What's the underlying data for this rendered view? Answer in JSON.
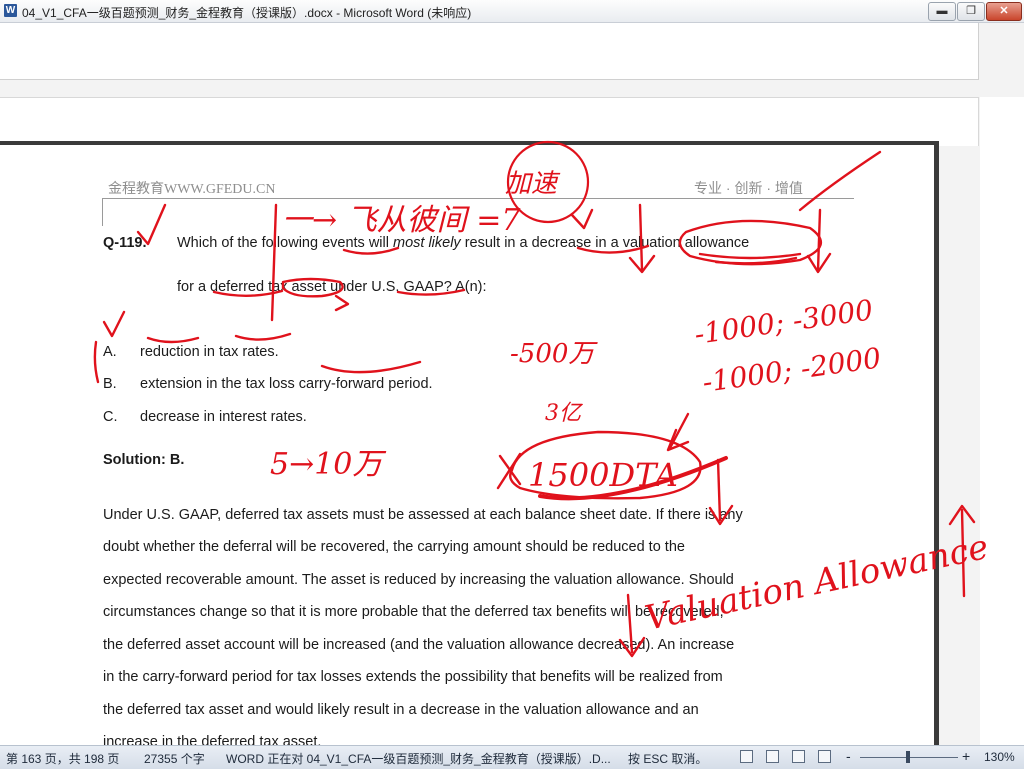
{
  "window": {
    "title": "04_V1_CFA一级百题预测_财务_金程教育（授课版）.docx - Microsoft Word (未响应)",
    "app_icon_letter": "W",
    "min_glyph": "▬",
    "max_glyph": "❐",
    "close_glyph": "✕"
  },
  "page_header": {
    "left": "金程教育WWW.GFEDU.CN",
    "right": "专业 · 创新 · 增值"
  },
  "question": {
    "number": "Q-119.",
    "line1_before": "Which of the following events will ",
    "line1_emphasis": "most likely",
    "line1_after": " result in a decrease in a valuation allowance",
    "line2": "for a deferred tax asset under U.S. GAAP? A(n):",
    "options": [
      {
        "letter": "A.",
        "text": "reduction in tax rates."
      },
      {
        "letter": "B.",
        "text": "extension in the tax loss carry-forward period."
      },
      {
        "letter": "C.",
        "text": "decrease in interest rates."
      }
    ]
  },
  "solution": {
    "title": "Solution: B.",
    "lines": [
      "Under U.S. GAAP, deferred tax assets must be assessed at each balance sheet date. If there is any",
      "doubt whether the deferral will be recovered, the carrying amount should be reduced to the",
      "expected recoverable amount. The asset is reduced by increasing the valuation allowance. Should",
      "circumstances change so that it is more probable that the deferred tax benefits will be recovered,",
      "the deferred asset account will be increased (and the valuation allowance decreased). An increase",
      "in the carry-forward period for tax losses extends the possibility that benefits will be realized from",
      "the deferred tax asset and would likely result in a decrease in the valuation allowance and an",
      "increase in the deferred tax asset."
    ]
  },
  "annotations": {
    "top_chinese": "一→ 飞从彼间 =7",
    "circled_chinese": "加速",
    "minus_500": "-500万",
    "thirty_million": "3亿",
    "five_to_ten": "5→10万",
    "dta": "1500DTA",
    "sequence_1": "-1000; -3000",
    "sequence_2": "-1000; -2000",
    "valuation_allowance": "Valuation Allowance"
  },
  "status_bar": {
    "page_info": "第 163 页，共 198 页",
    "word_count": "27355 个字",
    "word_status": "WORD 正在对 04_V1_CFA一级百题预测_财务_金程教育（授课版）.D...",
    "esc_hint": "按 ESC 取消。",
    "zoom": "130%",
    "zoom_minus": "-",
    "zoom_plus": "+"
  },
  "colors": {
    "ink": "#e0121c",
    "page_border": "#3a3a3a",
    "header_text": "#8e8e8e"
  }
}
